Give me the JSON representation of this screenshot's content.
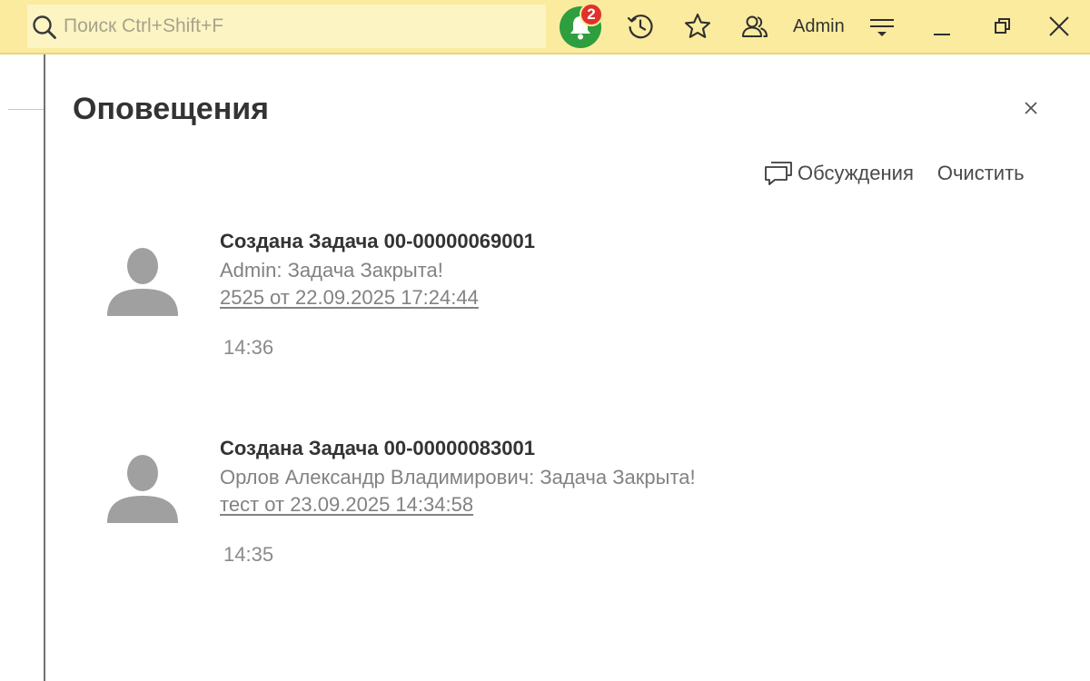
{
  "toolbar": {
    "search_placeholder": "Поиск Ctrl+Shift+F",
    "notification_count": "2",
    "user_name": "Admin",
    "icons": [
      "search-icon",
      "bell-icon",
      "history-icon",
      "star-icon",
      "users-icon",
      "menu-icon",
      "minimize-icon",
      "restore-icon",
      "close-icon"
    ]
  },
  "panel": {
    "title": "Оповещения",
    "discussions_label": "Обсуждения",
    "clear_label": "Очистить"
  },
  "notifications": [
    {
      "title": "Создана Задача 00-00000069001",
      "text": "Admin: Задача Закрыта!",
      "link": "2525 от 22.09.2025 17:24:44",
      "time": "14:36"
    },
    {
      "title": "Создана Задача 00-00000083001",
      "text": "Орлов Александр Владимирович: Задача Закрыта!",
      "link": "тест от 23.09.2025 14:34:58",
      "time": "14:35"
    }
  ],
  "colors": {
    "toolbar_bg": "#fbeb9f",
    "bell_green": "#2e9e3e",
    "badge_red": "#e0312a",
    "avatar_gray": "#a0a0a0"
  }
}
